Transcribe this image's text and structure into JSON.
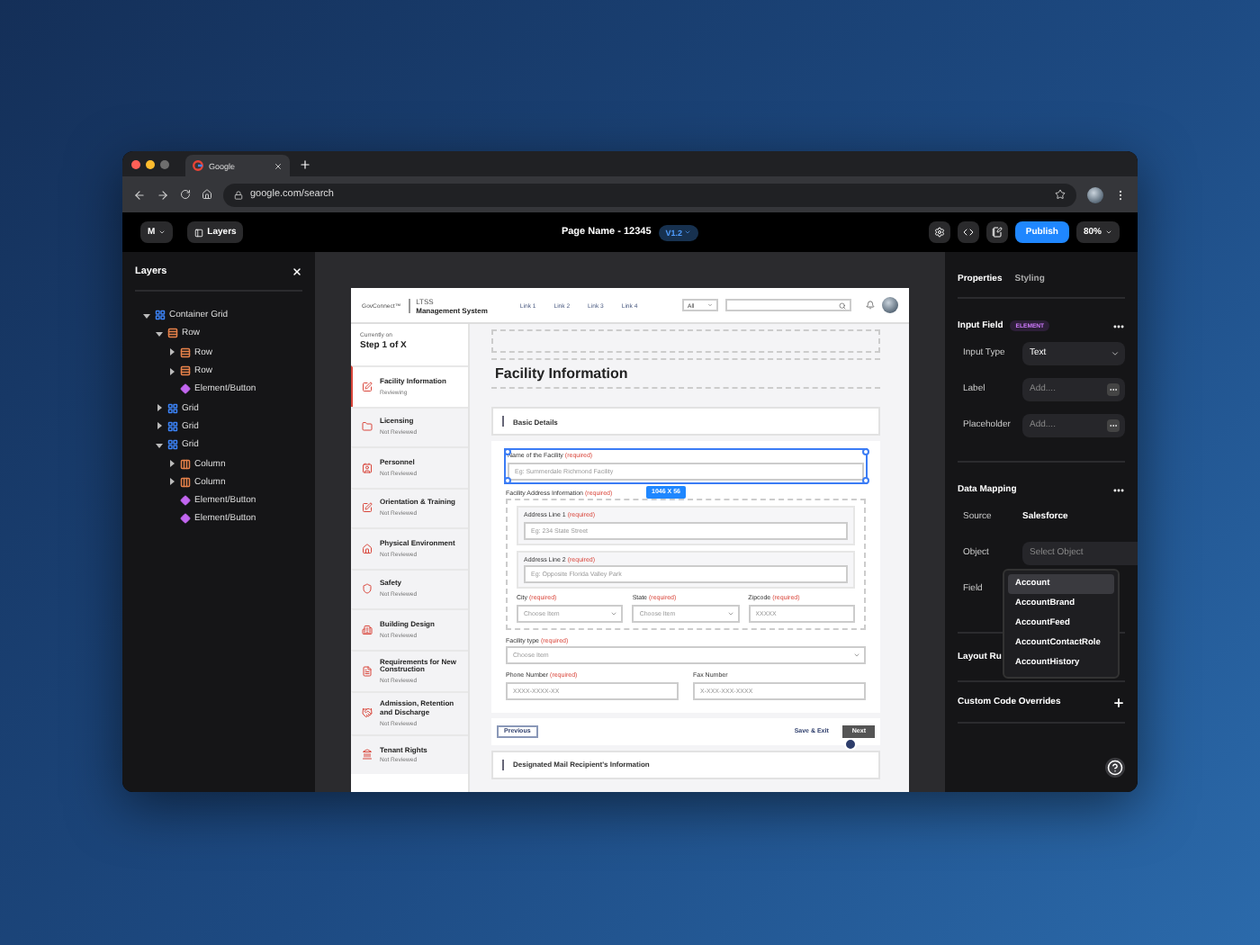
{
  "browser": {
    "tab": "Google",
    "url": "google.com/search"
  },
  "app_bar": {
    "workspace": "M",
    "layers_button": "Layers",
    "page_name": "Page Name - 12345",
    "version": "V1.2",
    "publish": "Publish",
    "zoom": "80%"
  },
  "layers": {
    "title": "Layers",
    "tree": [
      {
        "label": "Container Grid",
        "kind": "grid",
        "expanded": true,
        "children": [
          {
            "label": "Row",
            "kind": "row",
            "expanded": true,
            "children": [
              {
                "label": "Row",
                "kind": "row",
                "expanded": false
              },
              {
                "label": "Row",
                "kind": "row",
                "expanded": false
              },
              {
                "label": "Element/Button",
                "kind": "element"
              }
            ]
          },
          {
            "label": "Grid",
            "kind": "grid",
            "expanded": false
          },
          {
            "label": "Grid",
            "kind": "grid",
            "expanded": false
          },
          {
            "label": "Grid",
            "kind": "grid",
            "expanded": true,
            "children": [
              {
                "label": "Column",
                "kind": "column",
                "expanded": false
              },
              {
                "label": "Column",
                "kind": "column",
                "expanded": false
              },
              {
                "label": "Element/Button",
                "kind": "element"
              },
              {
                "label": "Element/Button",
                "kind": "element"
              }
            ]
          }
        ]
      }
    ]
  },
  "preview": {
    "header": {
      "brand": "GovConnect™",
      "product_top": "LTSS",
      "product": "Management System",
      "links": [
        "Link 1",
        "Link 2",
        "Link 3",
        "Link 4"
      ],
      "search_scope": "All"
    },
    "progress": {
      "caption": "Currently on",
      "step": "Step 1 of X"
    },
    "steps": [
      {
        "title": "Facility Information",
        "status": "Reviewing",
        "selected": true
      },
      {
        "title": "Licensing",
        "status": "Not Reviewed",
        "selected": false
      },
      {
        "title": "Personnel",
        "status": "Not Reviewed",
        "selected": false
      },
      {
        "title": "Orientation & Training",
        "status": "Not Reviewed",
        "selected": false
      },
      {
        "title": "Physical Environment",
        "status": "Not Reviewed",
        "selected": false
      },
      {
        "title": "Safety",
        "status": "Not Reviewed",
        "selected": false
      },
      {
        "title": "Building Design",
        "status": "Not Reviewed",
        "selected": false
      },
      {
        "title": "Requirements for New Construction",
        "status": "Not Reviewed",
        "selected": false
      },
      {
        "title": "Admission, Retention and Discharge",
        "status": "Not Reviewed",
        "selected": false
      },
      {
        "title": "Tenant Rights",
        "status": "Not Reviewed",
        "selected": false
      }
    ],
    "form": {
      "title": "Facility Information",
      "section": "Basic Details",
      "size_badge": "1046 X 56",
      "name_field": {
        "label": "Name of the Facility",
        "note": "(required)",
        "placeholder": "Eg: Summerdale Richmond Facility",
        "kind": "text",
        "selected": true
      },
      "address": {
        "label": "Facility Address Information",
        "note": "(required)",
        "lines": [
          {
            "label": "Address Line 1",
            "note": "(required)",
            "placeholder": "Eg: 234 State Street",
            "kind": "text"
          },
          {
            "label": "Address Line 2",
            "note": "(required)",
            "placeholder": "Eg: Opposite Florida Valley Park",
            "kind": "text"
          }
        ],
        "parts": [
          {
            "label": "City",
            "note": "(required)",
            "placeholder": "Choose Item",
            "kind": "select"
          },
          {
            "label": "State",
            "note": "(required)",
            "placeholder": "Choose Item",
            "kind": "select"
          },
          {
            "label": "Zipcode",
            "note": "(required)",
            "placeholder": "XXXXX",
            "kind": "text"
          }
        ]
      },
      "type_field": {
        "label": "Facility type",
        "note": "(required)",
        "placeholder": "Choose Item",
        "kind": "select"
      },
      "contact": [
        {
          "label": "Phone Number",
          "note": "(required)",
          "placeholder": "XXXX-XXXX-XX",
          "kind": "text"
        },
        {
          "label": "Fax Number",
          "placeholder": "X-XXX-XXX-XXXX",
          "kind": "text"
        }
      ],
      "footer": {
        "previous": "Previous",
        "save": "Save & Exit",
        "next": "Next"
      },
      "next_section": "Designated Mail Recipient's Information"
    }
  },
  "properties": {
    "tabs": [
      {
        "label": "Properties",
        "selected": true
      },
      {
        "label": "Styling",
        "selected": false
      }
    ],
    "input_field": {
      "title": "Input Field",
      "badge": "ELEMENT",
      "rows": [
        {
          "label": "Input Type",
          "value": "Text",
          "kind": "select"
        },
        {
          "label": "Label",
          "placeholder": "Add....",
          "kind": "text"
        },
        {
          "label": "Placeholder",
          "placeholder": "Add....",
          "kind": "text"
        }
      ]
    },
    "data_mapping": {
      "title": "Data Mapping",
      "rows": [
        {
          "label": "Source",
          "value": "Salesforce",
          "kind": "static"
        },
        {
          "label": "Object",
          "placeholder": "Select Object",
          "kind": "select",
          "menu": [
            {
              "label": "Account",
              "selected": true
            },
            {
              "label": "AccountBrand",
              "selected": false
            },
            {
              "label": "AccountFeed",
              "selected": false
            },
            {
              "label": "AccountContactRole",
              "selected": false
            },
            {
              "label": "AccountHistory",
              "selected": false
            }
          ]
        },
        {
          "label": "Field",
          "kind": "label"
        }
      ]
    },
    "sections": [
      {
        "title": "Layout Ru",
        "addable": false
      },
      {
        "title": "Custom Code Overrides",
        "addable": true
      }
    ]
  }
}
